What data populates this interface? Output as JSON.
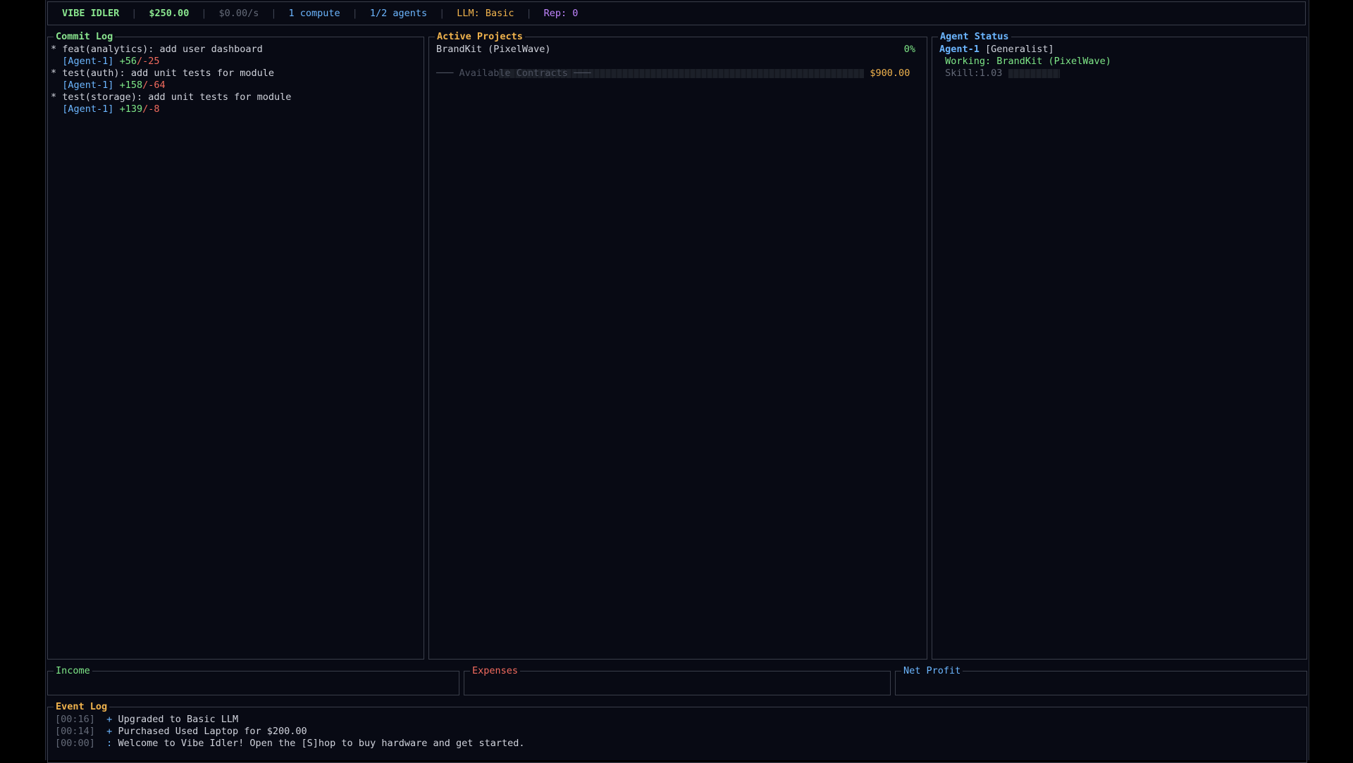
{
  "topbar": {
    "app_name": "VIBE IDLER",
    "money": "$250.00",
    "rate": "$0.00/s",
    "compute": "1 compute",
    "agents": "1/2 agents",
    "llm": "LLM: Basic",
    "rep": "Rep: 0"
  },
  "commit_log": {
    "title": "Commit Log",
    "commits": [
      {
        "bullet": "*",
        "message": "feat(analytics): add user dashboard",
        "agent": "[Agent-1]",
        "added": "+56",
        "removed": "/-25"
      },
      {
        "bullet": "*",
        "message": "test(auth): add unit tests for module",
        "agent": "[Agent-1]",
        "added": "+158",
        "removed": "/-64"
      },
      {
        "bullet": "*",
        "message": "test(storage): add unit tests for module",
        "agent": "[Agent-1]",
        "added": "+139",
        "removed": "/-8"
      }
    ]
  },
  "active_projects": {
    "title": "Active Projects",
    "projects": [
      {
        "name": "BrandKit (PixelWave)",
        "percent": "0%",
        "progress": 0,
        "payout": "$900.00"
      }
    ],
    "available_contracts_label": "─── Available Contracts ───"
  },
  "agent_status": {
    "title": "Agent Status",
    "agents": [
      {
        "name": "Agent-1",
        "role": "[Generalist]",
        "working": "Working: BrandKit (PixelWave)",
        "skill": "Skill:1.03"
      }
    ]
  },
  "finance": {
    "income_title": "Income",
    "expenses_title": "Expenses",
    "net_profit_title": "Net Profit"
  },
  "event_log": {
    "title": "Event Log",
    "events": [
      {
        "time": "[00:16]",
        "marker": "+",
        "text": "Upgraded to Basic LLM"
      },
      {
        "time": "[00:14]",
        "marker": "+",
        "text": "Purchased Used Laptop for $200.00"
      },
      {
        "time": "[00:00]",
        "marker": ":",
        "text": "Welcome to Vibe Idler! Open the [S]hop to buy hardware and get started."
      }
    ]
  },
  "colors": {
    "background": "#080a14",
    "border": "#3a3e4a",
    "green": "#7ee787",
    "blue": "#6cb6ff",
    "orange": "#f0b34d",
    "purple": "#c185ff",
    "red": "#f26b5e"
  }
}
